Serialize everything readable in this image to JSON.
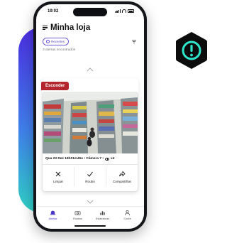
{
  "status_bar": {
    "time": "19:02"
  },
  "header": {
    "title": "Minha loja"
  },
  "filter": {
    "chip_label": "Recentes",
    "results_text": "3 alertas encontrados"
  },
  "card": {
    "hide_label": "Esconder",
    "meta_text": "Qua 23 Dez 19h01m45s • Câmera 7 •",
    "views": "x4",
    "actions": [
      {
        "label": "Limpar",
        "icon": "close-icon"
      },
      {
        "label": "Roubo",
        "icon": "check-icon"
      },
      {
        "label": "Compartilhar",
        "icon": "share-icon"
      }
    ]
  },
  "bottom_nav": [
    {
      "label": "Alertas",
      "icon": "alert-bell-icon",
      "active": true
    },
    {
      "label": "Roubos",
      "icon": "camera-icon",
      "active": false
    },
    {
      "label": "Estatísticas",
      "icon": "stats-icon",
      "active": false
    },
    {
      "label": "Conta",
      "icon": "user-icon",
      "active": false
    }
  ],
  "colors": {
    "accent": "#5b45c9",
    "hide_tab": "#b3262d",
    "alert_badge_bg": "#0c0c0c",
    "alert_badge_icon": "#2ee6c9",
    "glow_top": "#4b2de0",
    "glow_bottom": "#2fd1c4"
  }
}
